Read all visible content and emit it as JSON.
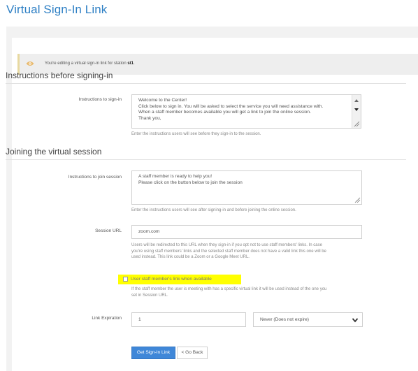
{
  "header": {
    "title": "Virtual Sign-In Link"
  },
  "notice": {
    "prefix": "You're editing a virtual sign-in link for station",
    "station": "st1",
    "suffix": "."
  },
  "section1": {
    "title": "Instructions before signing-in",
    "label": "Instructions to sign-in",
    "lines": [
      "Welcome to the Center!",
      "Click below to sign in. You will be asked to select the service you will need assistance with.",
      "When a staff member becomes available you will get a link to join the online session.",
      "Thank you,"
    ],
    "help": "Enter the instructions users will see before they sign-in to the session."
  },
  "section2": {
    "title": "Joining the virtual session",
    "join_label": "Instructions to join session",
    "join_lines": [
      "A staff member is ready to help you!",
      "Please click on the button below to join the session"
    ],
    "join_help": "Enter the instructions users will see after signing-in and before joining the online session.",
    "url_label": "Session URL",
    "url_value": "zoom.com",
    "url_help": [
      "Users will be redirected to this URL when they sign-in if you opt not to use staff members' links. In case",
      "you're using staff members' links and the selected staff member does not have a valid link this one will be",
      "used instead. This link could be a Zoom or a Google Meet URL."
    ],
    "checkbox_label": "User staff member's link when available",
    "checkbox_help": [
      "If the staff member the user is meeting with has a specific virtual link it will be used instead of the one you",
      "set in Session URL."
    ],
    "expiration_label": "Link Expiration",
    "expiration_value": "1",
    "expiration_select": "Never (Does not expire)"
  },
  "buttons": {
    "primary": "Get Sign-In Link",
    "back": "< Go Back"
  },
  "colors": {
    "accent": "#3f87d8",
    "title": "#2d7fc4",
    "highlight": "#ffff00"
  }
}
